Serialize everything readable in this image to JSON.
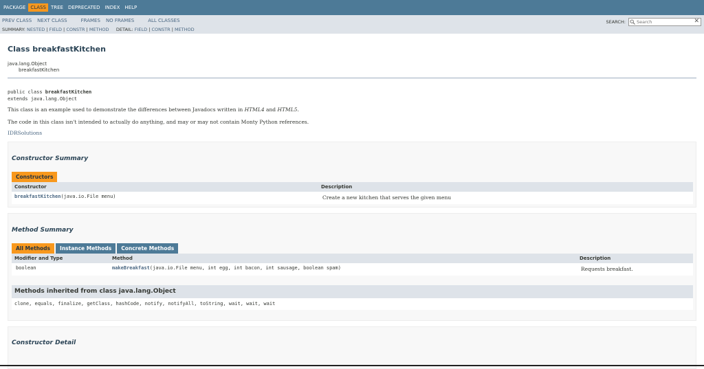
{
  "topnav": {
    "items": [
      {
        "label": "PACKAGE"
      },
      {
        "label": "CLASS",
        "active": true
      },
      {
        "label": "TREE"
      },
      {
        "label": "DEPRECATED"
      },
      {
        "label": "INDEX"
      },
      {
        "label": "HELP"
      }
    ]
  },
  "subnav": {
    "prev_class": "PREV CLASS",
    "next_class": "NEXT CLASS",
    "frames": "FRAMES",
    "no_frames": "NO FRAMES",
    "all_classes": "ALL CLASSES",
    "summary_label": "SUMMARY:",
    "summary_nested": "NESTED",
    "summary_field": "FIELD",
    "summary_constr": "CONSTR",
    "summary_method": "METHOD",
    "detail_label": "DETAIL:",
    "detail_field": "FIELD",
    "detail_constr": "CONSTR",
    "detail_method": "METHOD",
    "separator": "|"
  },
  "search": {
    "label": "SEARCH:",
    "placeholder": "Search",
    "reset": "✕"
  },
  "class": {
    "title": "Class breakfastKitchen",
    "parent": "java.lang.Object",
    "child": "breakfastKitchen",
    "sig_prefix": "public class ",
    "sig_name": "breakfastKitchen",
    "sig_extends": "extends java.lang.Object",
    "desc1_a": "This class is an example used to demonstrate the differences between Javadocs written in ",
    "desc1_html4": "HTML4",
    "desc1_and": " and ",
    "desc1_html5": "HTML5",
    "desc1_end": ".",
    "desc2": "The code in this class isn't intended to actually do anything, and may or may not contain Monty Python references.",
    "author": "IDRSolutions"
  },
  "constructor_summary": {
    "heading": "Constructor Summary",
    "tab": "Constructors",
    "col_constructor": "Constructor",
    "col_description": "Description",
    "row_name": "breakfastKitchen",
    "row_params": "(java.io.File menu)",
    "row_desc": "Create a new kitchen that serves the given menu"
  },
  "method_summary": {
    "heading": "Method Summary",
    "tabs": [
      {
        "label": "All Methods",
        "active": true
      },
      {
        "label": "Instance Methods"
      },
      {
        "label": "Concrete Methods"
      }
    ],
    "col_modifier": "Modifier and Type",
    "col_method": "Method",
    "col_description": "Description",
    "row_type": "boolean",
    "row_name": "makeBreakfast",
    "row_params": "(java.io.File menu, int egg, int bacon, int sausage, boolean spam)",
    "row_desc": "Requests breakfast.",
    "inherited_heading": "Methods inherited from class java.lang.Object",
    "inherited_list": "clone, equals, finalize, getClass, hashCode, notify, notifyAll, toString, wait, wait, wait"
  },
  "constructor_detail": {
    "heading": "Constructor Detail"
  }
}
